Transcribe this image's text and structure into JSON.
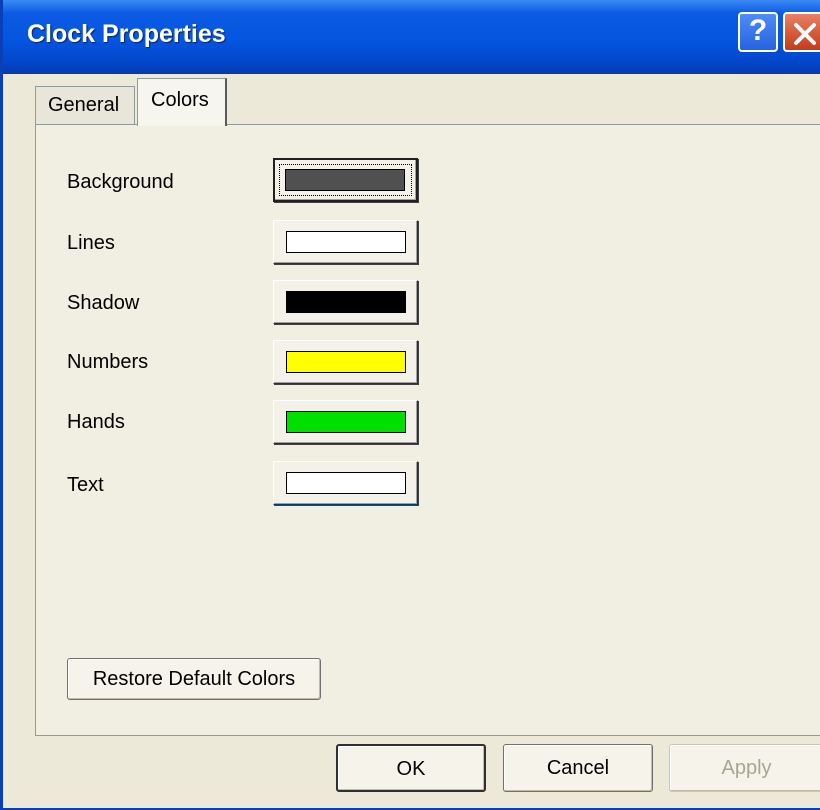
{
  "window": {
    "title": "Clock Properties",
    "help_glyph": "?",
    "titlebar_color": "#0455df"
  },
  "tabs": [
    {
      "label": "General",
      "selected": false
    },
    {
      "label": "Colors",
      "selected": true
    }
  ],
  "colors": {
    "items": [
      {
        "label": "Background",
        "color": "#505050",
        "focused": true
      },
      {
        "label": "Lines",
        "color": "#ffffff",
        "focused": false
      },
      {
        "label": "Shadow",
        "color": "#000000",
        "focused": false
      },
      {
        "label": "Numbers",
        "color": "#ffff00",
        "focused": false
      },
      {
        "label": "Hands",
        "color": "#00e000",
        "focused": false
      },
      {
        "label": "Text",
        "color": "#ffffff",
        "focused": false
      }
    ]
  },
  "buttons": {
    "restore": "Restore Default Colors",
    "ok": "OK",
    "cancel": "Cancel",
    "apply": "Apply",
    "apply_enabled": false
  },
  "icons": {
    "help": "help-icon",
    "close": "close-icon"
  }
}
